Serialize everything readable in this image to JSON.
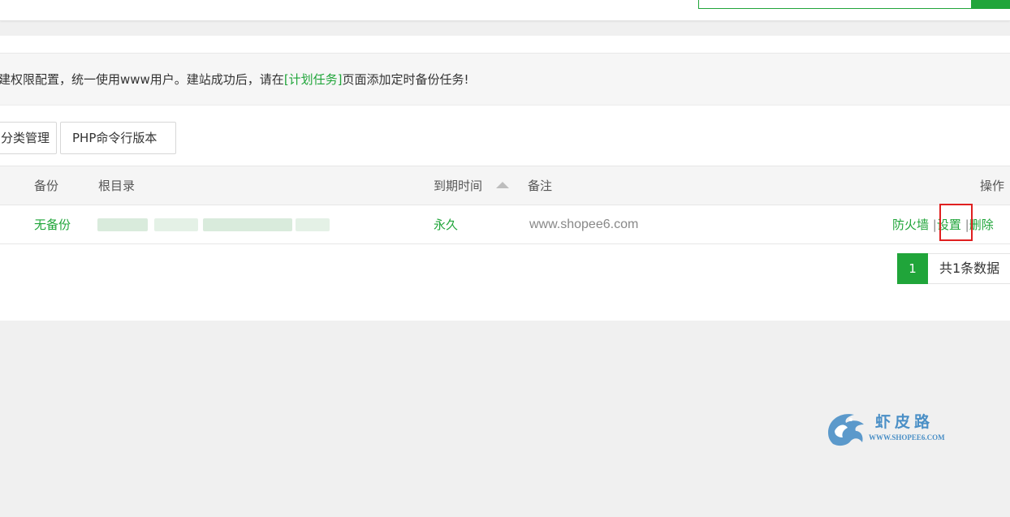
{
  "notice": {
    "before": "建权限配置，统一使用www用户。建站成功后，请在",
    "link": "[计划任务]",
    "after": "页面添加定时备份任务!"
  },
  "toolbar": {
    "category_button": "分类管理",
    "php_cli_button": "PHP命令行版本"
  },
  "table": {
    "headers": {
      "backup": "备份",
      "root": "根目录",
      "expire": "到期时间",
      "remark": "备注",
      "actions": "操作"
    },
    "rows": [
      {
        "backup": "无备份",
        "expire": "永久",
        "remark": "www.shopee6.com",
        "actions": {
          "firewall": "防火墙",
          "settings": "设置",
          "delete": "删除",
          "separator": "|"
        }
      }
    ]
  },
  "pagination": {
    "current_page": "1",
    "total_text": "共1条数据"
  },
  "watermark": {
    "title": "虾皮路",
    "url": "WWW.SHOPEE6.COM"
  },
  "colors": {
    "accent": "#20a53a",
    "highlight_box": "#e02020",
    "watermark": "#4a8fc6"
  }
}
